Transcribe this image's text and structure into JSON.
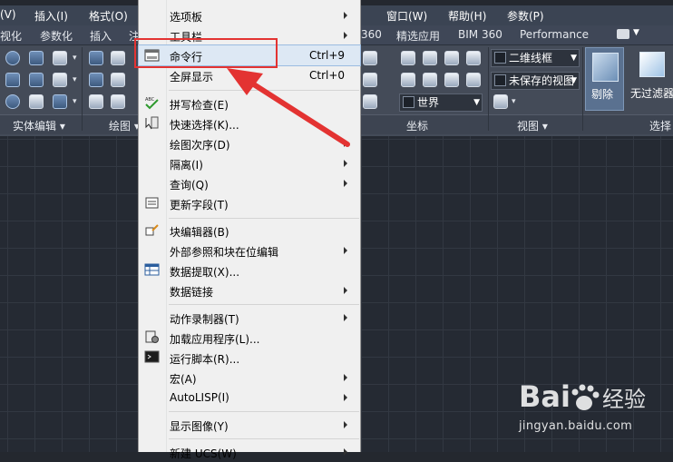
{
  "menubar": {
    "items": [
      "(V)",
      "插入(I)",
      "格式(O)",
      "窗口(W)",
      "帮助(H)",
      "参数(P)"
    ]
  },
  "ribbon_tabs": [
    "视化",
    "参数化",
    "插入",
    "注",
    "360",
    "精选应用",
    "BIM 360",
    "Performance"
  ],
  "panels": {
    "solid_edit": "实体编辑",
    "draw": "绘图",
    "coordinates": "坐标",
    "view": "视图",
    "select": "选择"
  },
  "view_controls": {
    "visual_style": "二维线框",
    "named_view": "未保存的视图",
    "ucs": "世界"
  },
  "buttons": {
    "cull": "剔除",
    "no_filter": "无过滤器"
  },
  "menu": {
    "items": [
      {
        "label": "选项板",
        "shortcut": "",
        "submenu": true
      },
      {
        "label": "工具栏",
        "shortcut": "",
        "submenu": true
      },
      {
        "label": "命令行",
        "shortcut": "Ctrl+9",
        "submenu": false,
        "highlighted": true
      },
      {
        "label": "全屏显示",
        "shortcut": "Ctrl+0",
        "submenu": false
      },
      {
        "label": "拼写检查(E)",
        "shortcut": "",
        "submenu": false
      },
      {
        "label": "快速选择(K)...",
        "shortcut": "",
        "submenu": false
      },
      {
        "label": "绘图次序(D)",
        "shortcut": "",
        "submenu": true
      },
      {
        "label": "隔离(I)",
        "shortcut": "",
        "submenu": true
      },
      {
        "label": "查询(Q)",
        "shortcut": "",
        "submenu": true
      },
      {
        "label": "更新字段(T)",
        "shortcut": "",
        "submenu": false
      },
      {
        "label": "块编辑器(B)",
        "shortcut": "",
        "submenu": false
      },
      {
        "label": "外部参照和块在位编辑",
        "shortcut": "",
        "submenu": true
      },
      {
        "label": "数据提取(X)...",
        "shortcut": "",
        "submenu": false
      },
      {
        "label": "数据链接",
        "shortcut": "",
        "submenu": true
      },
      {
        "label": "动作录制器(T)",
        "shortcut": "",
        "submenu": true
      },
      {
        "label": "加载应用程序(L)...",
        "shortcut": "",
        "submenu": false
      },
      {
        "label": "运行脚本(R)...",
        "shortcut": "",
        "submenu": false
      },
      {
        "label": "宏(A)",
        "shortcut": "",
        "submenu": true
      },
      {
        "label": "AutoLISP(I)",
        "shortcut": "",
        "submenu": true
      },
      {
        "label": "显示图像(Y)",
        "shortcut": "",
        "submenu": true
      },
      {
        "label": "新建 UCS(W)",
        "shortcut": "",
        "submenu": true
      }
    ]
  },
  "watermark": {
    "logo_text": "Bai 经验",
    "url": "jingyan.baidu.com"
  },
  "colors": {
    "highlight": "#e33332",
    "ribbon": "#444b58",
    "canvas": "#252a33"
  }
}
